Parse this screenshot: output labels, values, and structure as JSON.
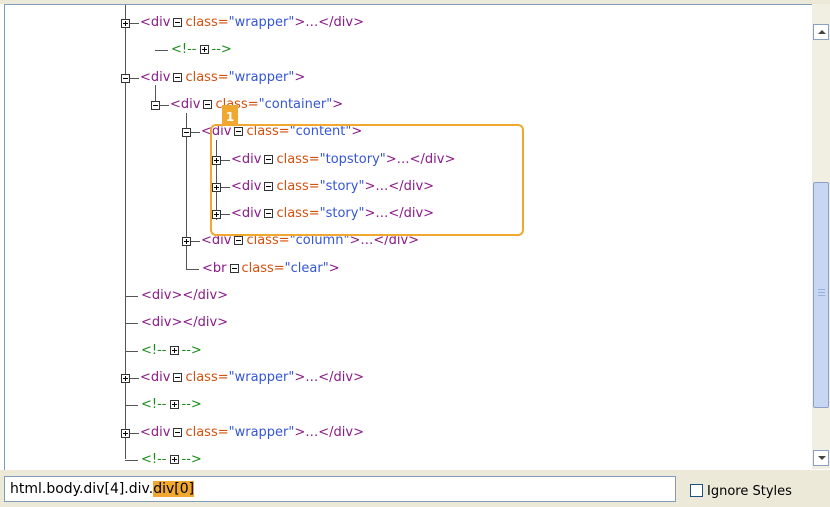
{
  "tree": {
    "rows": [
      {
        "kind": "elem",
        "tag": "<div",
        "attr": "class=",
        "val": "\"wrapper\"",
        "tail": ">…</div>",
        "expander": "plus"
      },
      {
        "kind": "comment",
        "open": "<!--",
        "close": "-->"
      },
      {
        "kind": "elem",
        "tag": "<div",
        "attr": "class=",
        "val": "\"wrapper\"",
        "tail": ">",
        "expander": "minus"
      },
      {
        "kind": "elem",
        "tag": "<div",
        "attr": "class=",
        "val": "\"container\"",
        "tail": ">",
        "expander": "minus"
      },
      {
        "kind": "elem",
        "tag": "<div",
        "attr": "class=",
        "val": "\"content\"",
        "tail": ">",
        "expander": "minus"
      },
      {
        "kind": "elem",
        "tag": "<div",
        "attr": "class=",
        "val": "\"topstory\"",
        "tail": ">…</div>",
        "expander": "plus"
      },
      {
        "kind": "elem",
        "tag": "<div",
        "attr": "class=",
        "val": "\"story\"",
        "tail": ">…</div>",
        "expander": "plus"
      },
      {
        "kind": "elem",
        "tag": "<div",
        "attr": "class=",
        "val": "\"story\"",
        "tail": ">…</div>",
        "expander": "plus"
      },
      {
        "kind": "elem",
        "tag": "<div",
        "attr": "class=",
        "val": "\"column\"",
        "tail": ">…</div>",
        "expander": "plus"
      },
      {
        "kind": "elem",
        "tag": "<br",
        "attr": "class=",
        "val": "\"clear\"",
        "tail": ">",
        "expander": "none"
      },
      {
        "kind": "simple",
        "text": "<div></div>"
      },
      {
        "kind": "simple",
        "text": "<div></div>"
      },
      {
        "kind": "comment",
        "open": "<!--",
        "close": "-->"
      },
      {
        "kind": "elem",
        "tag": "<div",
        "attr": "class=",
        "val": "\"wrapper\"",
        "tail": ">…</div>",
        "expander": "plus"
      },
      {
        "kind": "comment",
        "open": "<!--",
        "close": "-->"
      },
      {
        "kind": "elem",
        "tag": "<div",
        "attr": "class=",
        "val": "\"wrapper\"",
        "tail": ">…</div>",
        "expander": "plus"
      },
      {
        "kind": "comment",
        "open": "<!--",
        "close": "-->"
      }
    ],
    "selection_badge": "1"
  },
  "statusbar": {
    "path_prefix": "html.body.div[4].div.",
    "path_selected": "div[0]",
    "ignore_styles_label": "Ignore Styles",
    "ignore_styles_checked": false
  },
  "colors": {
    "tag": "#8b1a8b",
    "attr": "#d4500f",
    "value": "#3556d6",
    "comment": "#1a8a1a",
    "highlight": "#f0a830"
  }
}
